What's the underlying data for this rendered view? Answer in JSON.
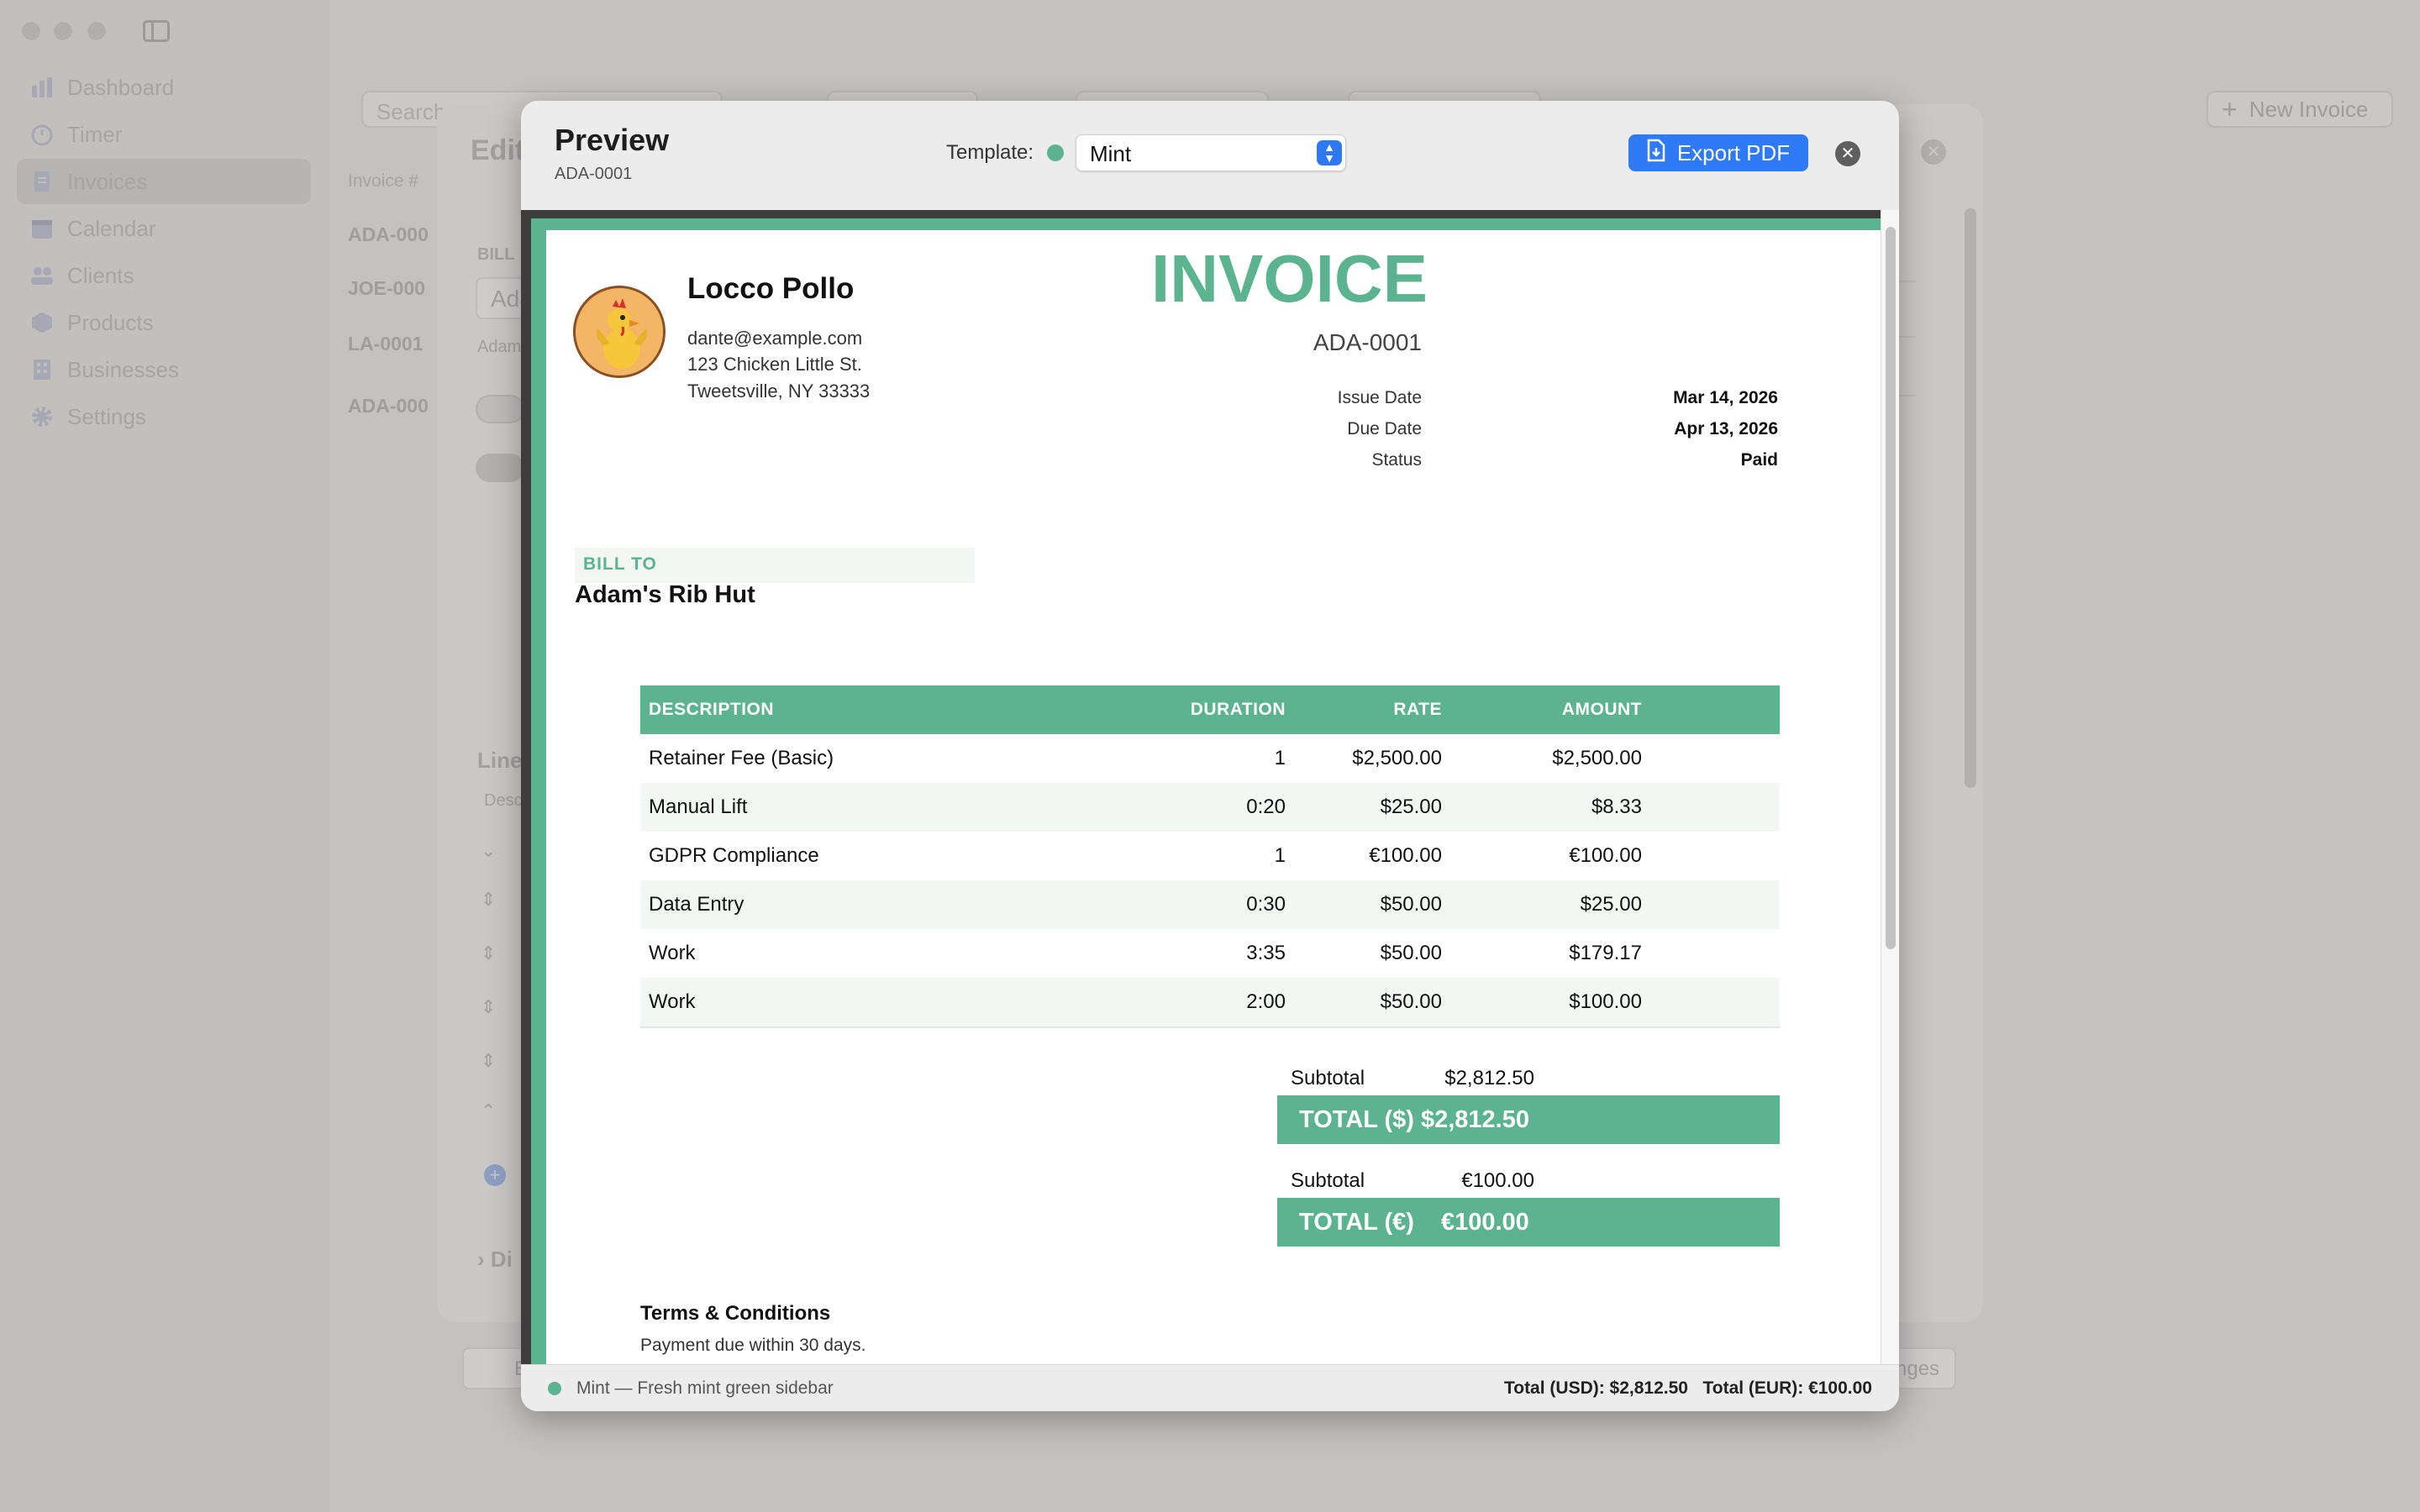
{
  "sidebar": {
    "items": [
      {
        "label": "Dashboard",
        "icon": "chart-bar-icon"
      },
      {
        "label": "Timer",
        "icon": "timer-icon"
      },
      {
        "label": "Invoices",
        "icon": "document-icon"
      },
      {
        "label": "Calendar",
        "icon": "calendar-icon"
      },
      {
        "label": "Clients",
        "icon": "people-icon"
      },
      {
        "label": "Products",
        "icon": "cube-icon"
      },
      {
        "label": "Businesses",
        "icon": "building-icon"
      },
      {
        "label": "Settings",
        "icon": "gear-icon"
      }
    ]
  },
  "background": {
    "search_placeholder": "Search",
    "new_invoice_label": "New Invoice",
    "list_header": "Invoice #",
    "list_items": [
      "ADA-000",
      "JOE-000",
      "LA-0001",
      "ADA-000"
    ],
    "editor_title": "Edit",
    "bill_label": "BILL",
    "bill_value": "Ada",
    "bill_sub": "Adam",
    "line_items_label": "Line",
    "desc_label": "Desc",
    "disclosure_label": "Di",
    "bottom_left_label": "E",
    "bottom_right_label": "nges"
  },
  "modal": {
    "title": "Preview",
    "subtitle": "ADA-0001",
    "template_label": "Template:",
    "template_value": "Mint",
    "export_label": "Export PDF",
    "accent_color": "#5cb38f",
    "button_color": "#2f7af6"
  },
  "invoice": {
    "business": {
      "name": "Locco Pollo",
      "email": "dante@example.com",
      "address1": "123 Chicken Little St.",
      "address2": "Tweetsville, NY 33333"
    },
    "heading": "INVOICE",
    "number": "ADA-0001",
    "meta": [
      {
        "label": "Issue Date",
        "value": "Mar 14, 2026"
      },
      {
        "label": "Due Date",
        "value": "Apr 13, 2026"
      },
      {
        "label": "Status",
        "value": "Paid"
      }
    ],
    "bill_to_label": "BILL TO",
    "bill_to_name": "Adam's Rib Hut",
    "columns": [
      "DESCRIPTION",
      "DURATION",
      "RATE",
      "AMOUNT"
    ],
    "rows": [
      {
        "description": "Retainer Fee (Basic)",
        "duration": "1",
        "rate": "$2,500.00",
        "amount": "$2,500.00"
      },
      {
        "description": "Manual Lift",
        "duration": "0:20",
        "rate": "$25.00",
        "amount": "$8.33"
      },
      {
        "description": "GDPR Compliance",
        "duration": "1",
        "rate": "€100.00",
        "amount": "€100.00"
      },
      {
        "description": "Data Entry",
        "duration": "0:30",
        "rate": "$50.00",
        "amount": "$25.00"
      },
      {
        "description": "Work",
        "duration": "3:35",
        "rate": "$50.00",
        "amount": "$179.17"
      },
      {
        "description": "Work",
        "duration": "2:00",
        "rate": "$50.00",
        "amount": "$100.00"
      }
    ],
    "totals": [
      {
        "subtotal_label": "Subtotal",
        "subtotal_value": "$2,812.50",
        "total_label": "TOTAL ($)",
        "total_value": "$2,812.50"
      },
      {
        "subtotal_label": "Subtotal",
        "subtotal_value": "€100.00",
        "total_label": "TOTAL (€)",
        "total_value": "€100.00"
      }
    ],
    "terms_title": "Terms & Conditions",
    "terms_text": "Payment due within 30 days."
  },
  "footer": {
    "template_desc": "Mint — Fresh mint green sidebar",
    "totals_text": "Total (USD): $2,812.50   Total (EUR): €100.00"
  }
}
